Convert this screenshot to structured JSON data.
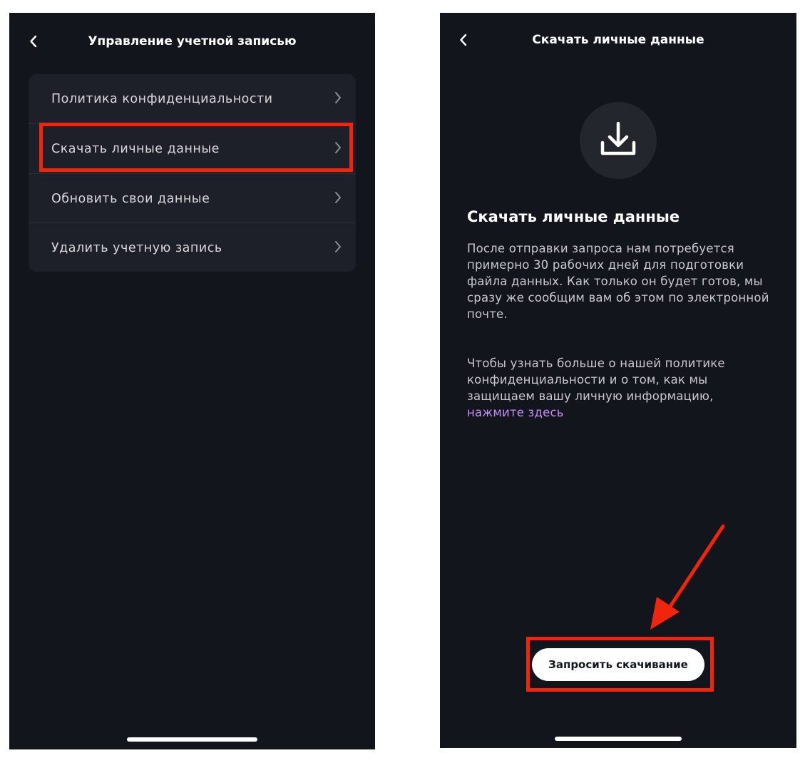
{
  "left_screen": {
    "title": "Управление учетной записью",
    "menu_items": [
      {
        "label": "Политика конфиденциальности"
      },
      {
        "label": "Скачать личные данные"
      },
      {
        "label": "Обновить свои данные"
      },
      {
        "label": "Удалить учетную запись"
      }
    ],
    "highlighted_item_index": 1
  },
  "right_screen": {
    "title": "Скачать личные данные",
    "icon": "download-icon",
    "heading": "Скачать личные данные",
    "paragraph1": "После отправки запроса нам потребуется примерно 30 рабочих дней для подготовки файла данных. Как только он будет готов, мы сразу же сообщим вам об этом по электронной почте.",
    "paragraph2": "Чтобы узнать больше о нашей политике конфиденциальности и о том, как мы защищаем вашу личную информацию,",
    "link_text": "нажмите здесь",
    "button_label": "Запросить скачивание"
  },
  "colors": {
    "background": "#12151b",
    "card": "#1d2028",
    "highlight": "#f1250d",
    "link": "#c58cf7",
    "button": "#ffffff"
  }
}
